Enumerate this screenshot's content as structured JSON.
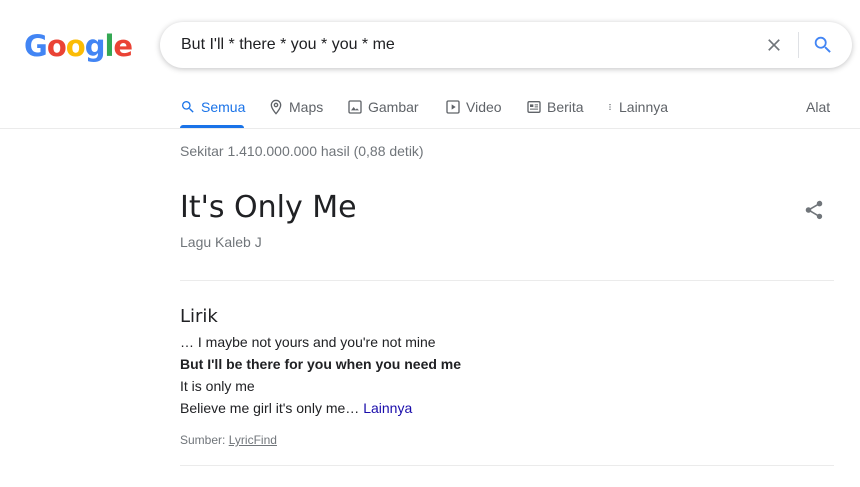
{
  "logo": {
    "letters": [
      "G",
      "o",
      "o",
      "g",
      "l",
      "e"
    ],
    "colors": [
      "#4285f4",
      "#ea4335",
      "#fbbc05",
      "#4285f4",
      "#34a853",
      "#ea4335"
    ]
  },
  "search": {
    "query": "But I'll * there * you * you * me",
    "clear_icon": "close-icon",
    "search_icon": "search-icon"
  },
  "tabs": {
    "items": [
      {
        "label": "Semua",
        "icon": "search-icon",
        "active": true
      },
      {
        "label": "Maps",
        "icon": "map-pin-icon"
      },
      {
        "label": "Gambar",
        "icon": "image-icon"
      },
      {
        "label": "Video",
        "icon": "video-icon"
      },
      {
        "label": "Berita",
        "icon": "news-icon"
      },
      {
        "label": "Lainnya",
        "icon": "more-vert-icon"
      }
    ],
    "tools": "Alat"
  },
  "result_stats": "Sekitar 1.410.000.000 hasil (0,88 detik)",
  "knowledge_panel": {
    "title": "It's Only Me",
    "subtitle": "Lagu Kaleb J",
    "lyrics_heading": "Lirik",
    "lines": [
      "… I maybe not yours and you're not mine",
      "But I'll be there for you when you need me",
      "It is only me",
      "Believe me girl it's only me…"
    ],
    "more_link": "Lainnya",
    "source_label": "Sumber:",
    "source_link": "LyricFind"
  },
  "colors": {
    "accent": "#1a73e8",
    "link": "#1a0dab",
    "muted": "#70757a"
  }
}
